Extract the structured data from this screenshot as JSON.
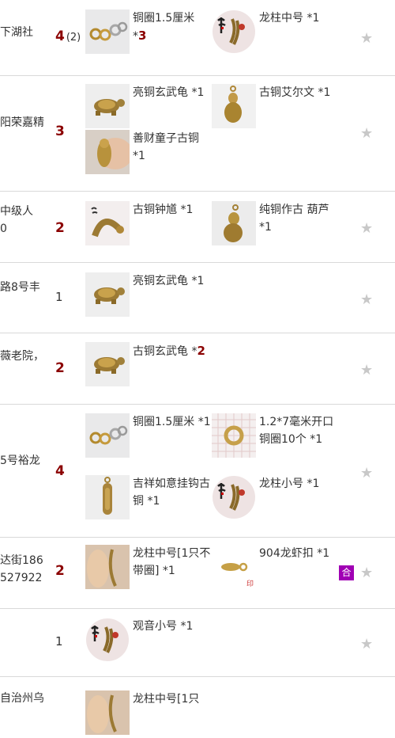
{
  "rows": [
    {
      "address": "下湖社",
      "quantity": "4",
      "quantity_sub": "(2)",
      "items": [
        {
          "name": "铜圈1.5厘米",
          "count_prefix": "*",
          "count": "3",
          "count_bold": true,
          "icon": "rings-icon"
        },
        {
          "name": "龙柱中号",
          "count_prefix": "*",
          "count": "1",
          "count_bold": false,
          "icon": "calligraphy-dragon-icon"
        }
      ]
    },
    {
      "address": "阳荣嘉精",
      "quantity": "3",
      "items": [
        {
          "name": "亮铜玄武龟",
          "count_prefix": "*",
          "count": "1",
          "count_bold": false,
          "icon": "turtle-icon"
        },
        {
          "name": "古铜艾尔文",
          "count_prefix": "*",
          "count": "1",
          "count_bold": false,
          "icon": "gourd-figure-icon"
        },
        {
          "name": "善财童子古铜",
          "count_prefix": "*",
          "count": "1",
          "count_bold": false,
          "icon": "boy-figure-icon"
        }
      ]
    },
    {
      "address": "中级人",
      "address2": "0",
      "quantity": "2",
      "items": [
        {
          "name": "古铜钟馗",
          "count_prefix": "*",
          "count": "1",
          "count_bold": false,
          "icon": "zhongkui-icon"
        },
        {
          "name": "纯铜作古 葫芦",
          "count_prefix": "*",
          "count": "1",
          "count_bold": false,
          "icon": "gourd-icon"
        }
      ]
    },
    {
      "address": "路8号丰",
      "quantity": "1",
      "items": [
        {
          "name": "亮铜玄武龟",
          "count_prefix": "*",
          "count": "1",
          "count_bold": false,
          "icon": "turtle-icon"
        }
      ]
    },
    {
      "address": "薇老院，",
      "quantity": "2",
      "items": [
        {
          "name": "古铜玄武龟",
          "count_prefix": "*",
          "count": "2",
          "count_bold": true,
          "icon": "turtle-icon"
        }
      ]
    },
    {
      "address": "5号裕龙",
      "quantity": "4",
      "items": [
        {
          "name": "铜圈1.5厘米",
          "count_prefix": "*",
          "count": "1",
          "count_bold": false,
          "icon": "rings-icon"
        },
        {
          "name": "1.2*7毫米开口铜圈10个",
          "count_prefix": "*",
          "count": "1",
          "count_bold": false,
          "icon": "split-ring-icon"
        },
        {
          "name": "吉祥如意挂钩古铜",
          "count_prefix": "*",
          "count": "1",
          "count_bold": false,
          "icon": "pendant-icon"
        },
        {
          "name": "龙柱小号",
          "count_prefix": "*",
          "count": "1",
          "count_bold": false,
          "icon": "calligraphy-dragon-icon"
        }
      ]
    },
    {
      "address": "达街186",
      "address2": "527922",
      "quantity": "2",
      "badge": "合",
      "items": [
        {
          "name": "龙柱中号[1只不带圈]",
          "count_prefix": "*",
          "count": "1",
          "count_bold": false,
          "icon": "hand-chain-icon"
        },
        {
          "name": "904龙虾扣",
          "count_prefix": "*",
          "count": "1",
          "count_bold": false,
          "icon": "lobster-clasp-icon"
        }
      ]
    },
    {
      "address": "",
      "quantity": "1",
      "items": [
        {
          "name": "观音小号",
          "count_prefix": "*",
          "count": "1",
          "count_bold": false,
          "icon": "calligraphy-dragon-icon"
        }
      ]
    },
    {
      "address": "自治州乌",
      "quantity": "",
      "items": [
        {
          "name": "龙柱中号[1只",
          "count_prefix": "",
          "count": "",
          "count_bold": false,
          "icon": "hand-chain-icon"
        }
      ]
    }
  ],
  "star_glyph": "★",
  "colors": {
    "quantity_accent": "#8b0000",
    "badge_bg": "#a000b4",
    "star": "#c8c8c8",
    "divider": "#d9d9d9"
  }
}
